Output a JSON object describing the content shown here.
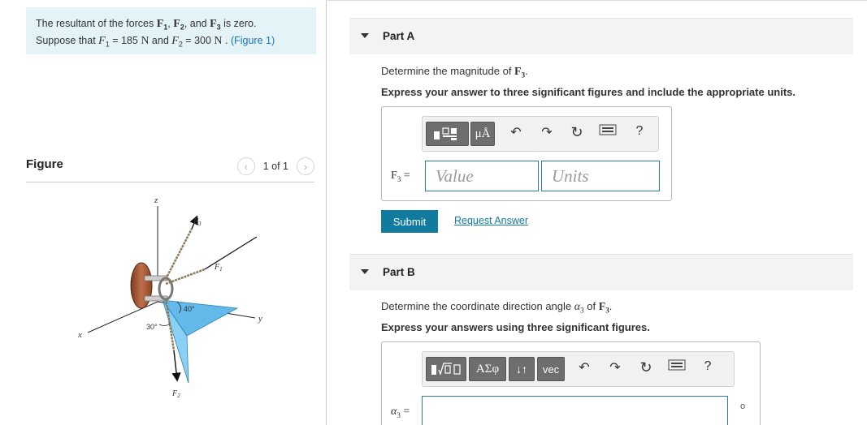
{
  "problem": {
    "line1_pre": "The resultant of the forces ",
    "F1": "F",
    "F1_sub": "1",
    "sep1": ", ",
    "F2": "F",
    "F2_sub": "2",
    "sep2": ", and ",
    "F3": "F",
    "F3_sub": "3",
    "line1_post": " is zero.",
    "line2_pre": "Suppose that ",
    "f1_it": "F",
    "f1_sub": "1",
    "f1_val": " = 185 ",
    "unit_N1": "N",
    "and": " and ",
    "f2_it": "F",
    "f2_sub": "2",
    "f2_val": " = 300 ",
    "unit_N2": "N",
    "dot": " . ",
    "figure_link": "(Figure 1)"
  },
  "figure_panel": {
    "title": "Figure",
    "page": "1 of 1",
    "prev_icon": "‹",
    "next_icon": "›",
    "labels": {
      "z": "z",
      "x": "x",
      "y": "y",
      "F3": "F",
      "F3_sub": "3",
      "F1": "F",
      "F1_sub": "1",
      "F2": "F",
      "F2_sub": "2",
      "angle40": "40°",
      "angle30": "30°"
    }
  },
  "part_a": {
    "header": "Part A",
    "question_pre": "Determine the magnitude of ",
    "question_var": "F",
    "question_sub": "3",
    "question_post": ".",
    "instruction": "Express your answer to three significant figures and include the appropriate units.",
    "toolbar": {
      "template_icon": "templates-icon",
      "units_label": "μÅ",
      "undo_icon": "↶",
      "redo_icon": "↷",
      "reset_icon": "↻",
      "keyboard_icon": "keyboard-icon",
      "help_label": "?"
    },
    "field_label_var": "F",
    "field_label_sub": "3",
    "field_label_eq": " =",
    "value_placeholder": "Value",
    "units_placeholder": "Units",
    "submit_label": "Submit",
    "request_answer": "Request Answer"
  },
  "part_b": {
    "header": "Part B",
    "question_pre": "Determine the coordinate direction angle ",
    "question_alpha": "α",
    "question_alpha_sub": "3",
    "question_of": " of ",
    "question_var": "F",
    "question_sub": "3",
    "question_post": ".",
    "instruction": "Express your answers using three significant figures.",
    "toolbar": {
      "template_icon": "templates-icon",
      "greek_label": "ΑΣφ",
      "arrows_label": "↓↑",
      "vec_label": "vec",
      "undo_icon": "↶",
      "redo_icon": "↷",
      "reset_icon": "↻",
      "keyboard_icon": "keyboard-icon",
      "help_label": "?"
    },
    "field_label_alpha": "α",
    "field_label_sub": "3",
    "field_label_eq": " =",
    "degree_unit": "o"
  },
  "colors": {
    "accent": "#117a9f",
    "problem_bg": "#e4f3f8",
    "header_bg": "#f3f3f3",
    "figure_blue": "#62b9ea"
  }
}
